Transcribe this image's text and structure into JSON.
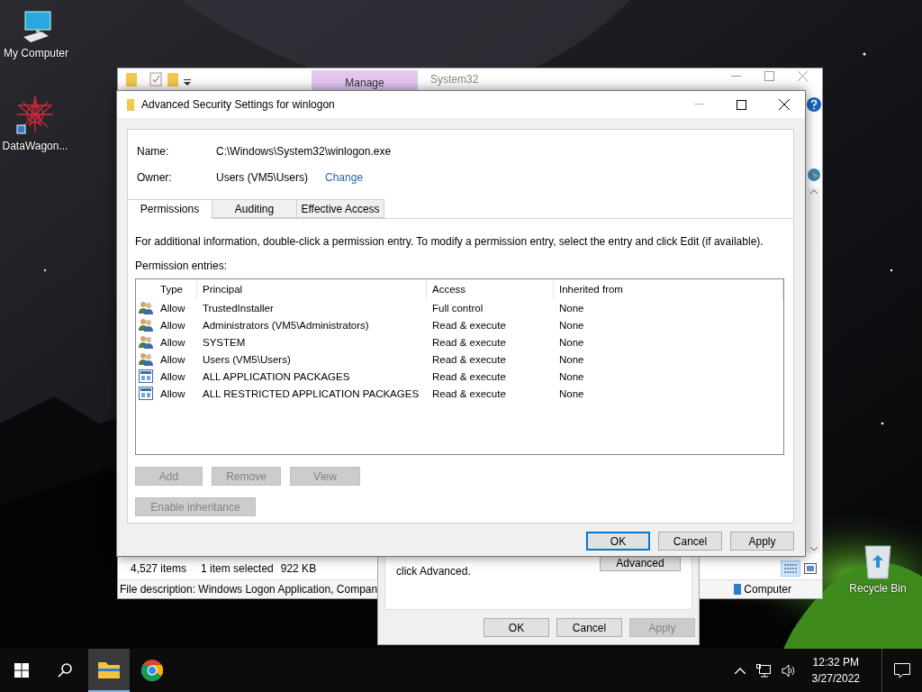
{
  "desktop_icons": [
    {
      "kind": "computer",
      "label": "My Computer"
    },
    {
      "kind": "app",
      "label": "DataWagon..."
    },
    {
      "kind": "recycle",
      "label": "Recycle Bin"
    }
  ],
  "explorer": {
    "ribbon_tab": "Manage",
    "title": "System32",
    "status": {
      "items": "4,527 items",
      "selected": "1 item selected",
      "size": "922 KB"
    },
    "details": "File description: Windows Logon Application, Compan",
    "location": "Computer"
  },
  "properties_dialog": {
    "note": "click Advanced.",
    "advanced_button": "Advanced",
    "buttons": [
      {
        "label": "OK",
        "disabled": false
      },
      {
        "label": "Cancel",
        "disabled": false
      },
      {
        "label": "Apply",
        "disabled": true
      }
    ]
  },
  "dialog": {
    "title": "Advanced Security Settings for winlogon",
    "name_label": "Name:",
    "name_value": "C:\\Windows\\System32\\winlogon.exe",
    "owner_label": "Owner:",
    "owner_value": "Users (VM5\\Users)",
    "owner_link": "Change",
    "tabs": [
      {
        "label": "Permissions",
        "selected": true
      },
      {
        "label": "Auditing",
        "selected": false
      },
      {
        "label": "Effective Access",
        "selected": false
      }
    ],
    "info": "For additional information, double-click a permission entry. To modify a permission entry, select the entry and click Edit (if available).",
    "entries_label": "Permission entries:",
    "table": {
      "columns": [
        "Type",
        "Principal",
        "Access",
        "Inherited from"
      ],
      "rows": [
        {
          "kind": "group",
          "type": "Allow",
          "principal": "TrustedInstaller",
          "access": "Full control",
          "inherited": "None"
        },
        {
          "kind": "group",
          "type": "Allow",
          "principal": "Administrators (VM5\\Administrators)",
          "access": "Read & execute",
          "inherited": "None"
        },
        {
          "kind": "group",
          "type": "Allow",
          "principal": "SYSTEM",
          "access": "Read & execute",
          "inherited": "None"
        },
        {
          "kind": "group",
          "type": "Allow",
          "principal": "Users (VM5\\Users)",
          "access": "Read & execute",
          "inherited": "None"
        },
        {
          "kind": "package",
          "type": "Allow",
          "principal": "ALL APPLICATION PACKAGES",
          "access": "Read & execute",
          "inherited": "None"
        },
        {
          "kind": "package",
          "type": "Allow",
          "principal": "ALL RESTRICTED APPLICATION PACKAGES",
          "access": "Read & execute",
          "inherited": "None"
        }
      ]
    },
    "entry_buttons": [
      {
        "label": "Add",
        "disabled": true
      },
      {
        "label": "Remove",
        "disabled": true
      },
      {
        "label": "View",
        "disabled": true
      }
    ],
    "inheritance_button": {
      "label": "Enable inheritance",
      "disabled": true
    },
    "buttons": [
      {
        "label": "OK",
        "default": true
      },
      {
        "label": "Cancel",
        "default": false
      },
      {
        "label": "Apply",
        "default": false
      }
    ]
  },
  "taskbar": {
    "apps": [
      {
        "kind": "explorer",
        "active": true
      },
      {
        "kind": "chrome",
        "active": false
      }
    ],
    "time": "12:32 PM",
    "date": "3/27/2022"
  }
}
